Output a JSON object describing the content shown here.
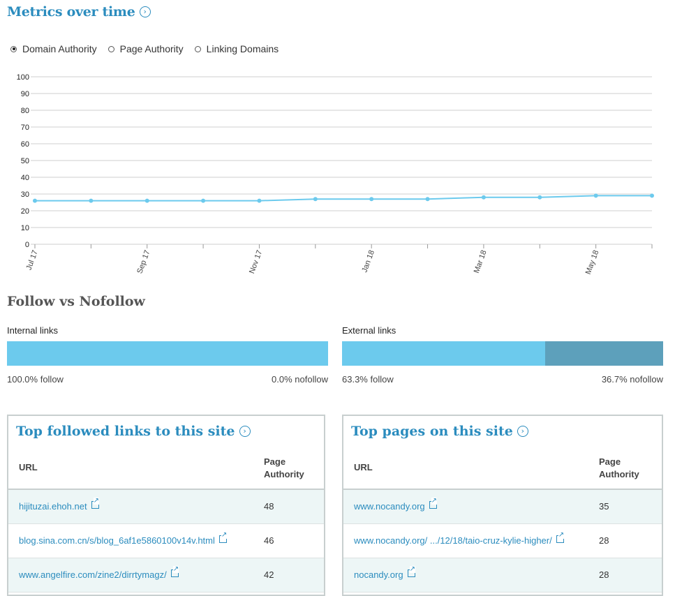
{
  "metrics": {
    "title": "Metrics over time",
    "radio_options": [
      "Domain Authority",
      "Page Authority",
      "Linking Domains"
    ],
    "selected": 0
  },
  "chart_data": {
    "type": "line",
    "y_ticks": [
      0,
      10,
      20,
      30,
      40,
      50,
      60,
      70,
      80,
      90,
      100
    ],
    "ylim": [
      0,
      100
    ],
    "x_tick_labels": [
      "Jul 17",
      "Sep 17",
      "Nov 17",
      "Jan 18",
      "Mar 18",
      "May 18"
    ],
    "x": [
      "Jul 17",
      "Aug 17",
      "Sep 17",
      "Oct 17",
      "Nov 17",
      "Dec 17",
      "Jan 18",
      "Feb 18",
      "Mar 18",
      "Apr 18",
      "May 18",
      "Jun 18"
    ],
    "series": [
      {
        "values": [
          26,
          26,
          26,
          26,
          26,
          27,
          27,
          27,
          28,
          28,
          29,
          29
        ]
      }
    ],
    "grid": true,
    "colors": {
      "line": "#6ccaed",
      "grid": "#cfcfcf"
    }
  },
  "follow": {
    "title": "Follow vs Nofollow",
    "internal": {
      "label": "Internal links",
      "follow": 100.0,
      "follow_text": "100.0% follow",
      "nofollow_text": "0.0% nofollow"
    },
    "external": {
      "label": "External links",
      "follow": 63.3,
      "follow_text": "63.3% follow",
      "nofollow_text": "36.7% nofollow"
    },
    "colors": {
      "follow": "#6ccaed",
      "nofollow": "#5da0bb"
    }
  },
  "top_links": {
    "title": "Top followed links to this site",
    "col_url": "URL",
    "col_pa_1": "Page",
    "col_pa_2": "Authority",
    "rows": [
      {
        "url": "hijituzai.ehoh.net",
        "pa": "48"
      },
      {
        "url": "blog.sina.com.cn/s/blog_6af1e5860100v14v.html",
        "pa": "46"
      },
      {
        "url": "www.angelfire.com/zine2/dirrtymagz/",
        "pa": "42"
      }
    ]
  },
  "top_pages": {
    "title": "Top pages on this site",
    "col_url": "URL",
    "col_pa_1": "Page",
    "col_pa_2": "Authority",
    "rows": [
      {
        "url": "www.nocandy.org",
        "pa": "35"
      },
      {
        "url": "www.nocandy.org/ .../12/18/taio-cruz-kylie-higher/",
        "pa": "28"
      },
      {
        "url": "nocandy.org",
        "pa": "28"
      }
    ]
  }
}
